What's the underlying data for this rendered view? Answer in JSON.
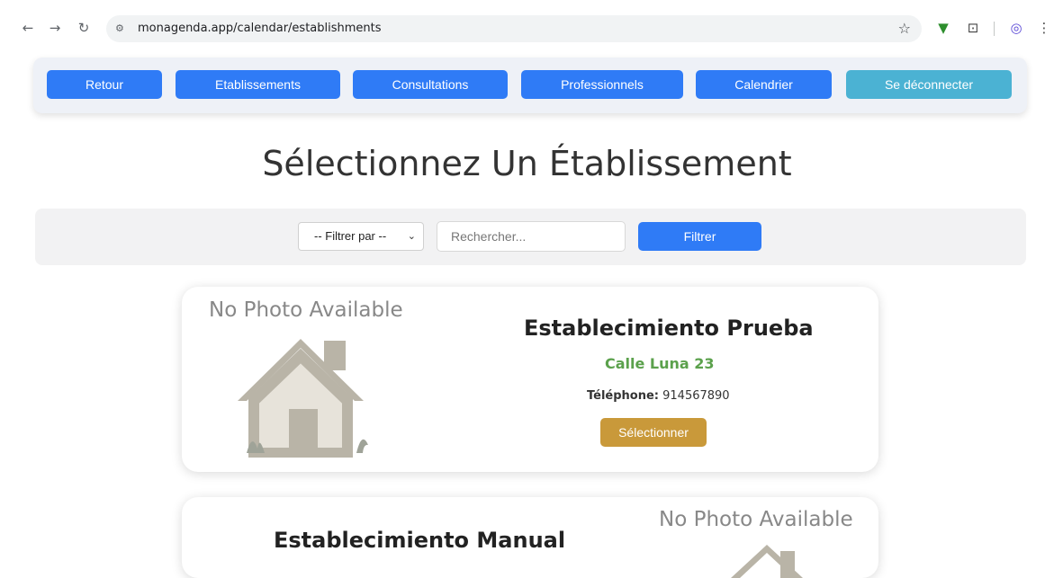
{
  "browser": {
    "url": "monagenda.app/calendar/establishments",
    "icons": [
      "back-icon",
      "forward-icon",
      "reload-icon",
      "site-info-icon",
      "star-icon",
      "download-icon",
      "extensions-icon",
      "profile-icon",
      "menu-icon"
    ]
  },
  "nav": {
    "back": "Retour",
    "establishments": "Etablissements",
    "consultations": "Consultations",
    "professionals": "Professionnels",
    "calendar": "Calendrier",
    "logout": "Se déconnecter"
  },
  "page": {
    "title": "Sélectionnez Un Établissement"
  },
  "filter": {
    "select_value": "-- Filtrer par --",
    "search_placeholder": "Rechercher...",
    "button": "Filtrer"
  },
  "establishments": [
    {
      "photo": "No Photo Available",
      "name": "Establecimiento Prueba",
      "address": "Calle Luna 23",
      "phone_label": "Téléphone:",
      "phone": "914567890",
      "select_label": "Sélectionner"
    },
    {
      "photo": "No Photo Available",
      "name": "Establecimiento Manual"
    }
  ],
  "colors": {
    "primary": "#2f7bf6",
    "logout": "#4bb2d3",
    "accent": "#c9993a",
    "address": "#5ba14c"
  }
}
